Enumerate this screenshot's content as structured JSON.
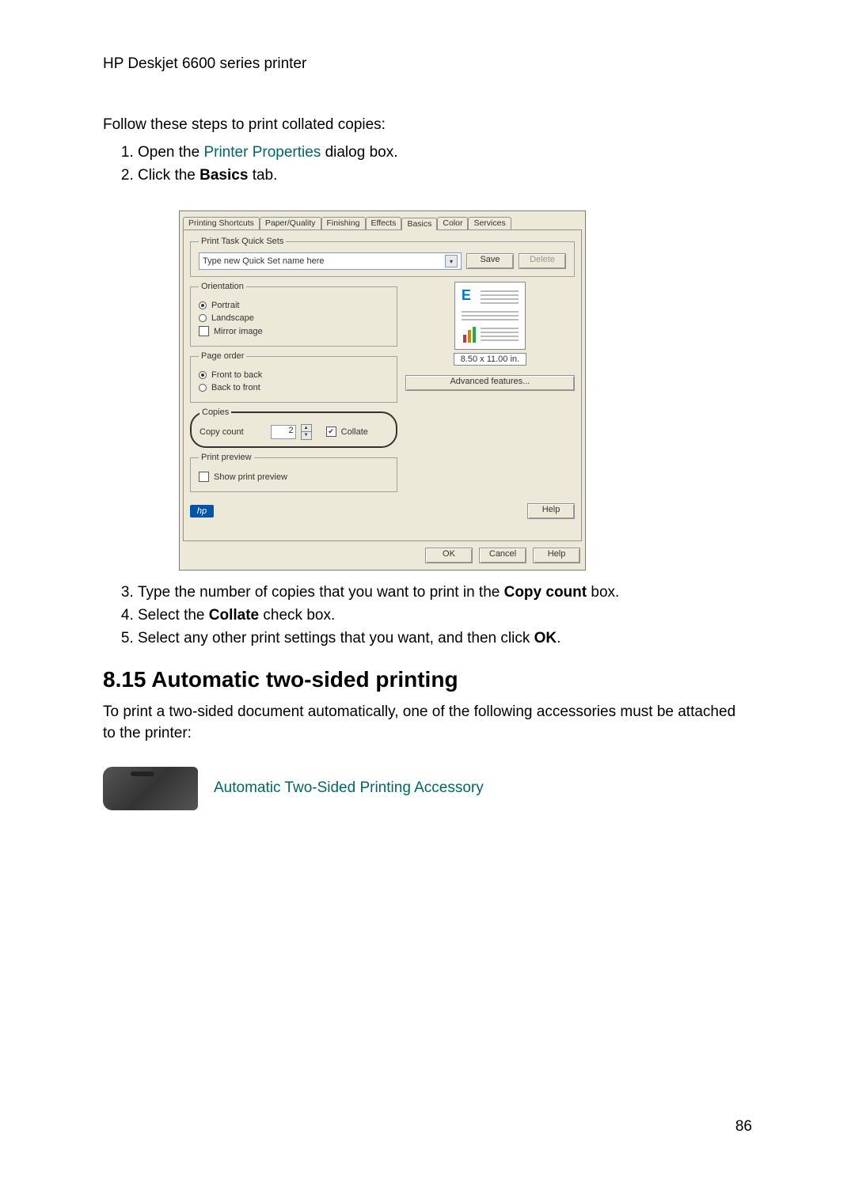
{
  "header": "HP Deskjet 6600 series printer",
  "intro": "Follow these steps to print collated copies:",
  "steps12": {
    "s1a": "Open the ",
    "s1_link": "Printer Properties",
    "s1b": " dialog box.",
    "s2a": "Click the ",
    "s2_bold": "Basics",
    "s2b": " tab."
  },
  "dialog": {
    "tabs": {
      "t0": "Printing Shortcuts",
      "t1": "Paper/Quality",
      "t2": "Finishing",
      "t3": "Effects",
      "t4": "Basics",
      "t5": "Color",
      "t6": "Services"
    },
    "quickset": {
      "legend": "Print Task Quick Sets",
      "placeholder": "Type new Quick Set name here",
      "save": "Save",
      "delete": "Delete"
    },
    "orientation": {
      "legend": "Orientation",
      "portrait": "Portrait",
      "landscape": "Landscape",
      "mirror": "Mirror image"
    },
    "pageorder": {
      "legend": "Page order",
      "ftb": "Front to back",
      "btf": "Back to front"
    },
    "copies": {
      "legend": "Copies",
      "label": "Copy count",
      "val": "2",
      "collate": "Collate"
    },
    "preview": {
      "legend": "Print preview",
      "show": "Show print preview"
    },
    "sizelabel": "8.50 x 11.00 in.",
    "advanced": "Advanced features...",
    "help1": "Help",
    "ok": "OK",
    "cancel": "Cancel",
    "help2": "Help",
    "hp": "hp"
  },
  "steps345": {
    "s3a": "Type the number of copies that you want to print in the ",
    "s3_bold": "Copy count",
    "s3b": " box.",
    "s4a": "Select the ",
    "s4_bold": "Collate",
    "s4b": " check box.",
    "s5a": "Select any other print settings that you want, and then click ",
    "s5_bold": "OK",
    "s5b": "."
  },
  "section": {
    "title": "8.15  Automatic two-sided printing",
    "body": "To print a two-sided document automatically, one of the following accessories must be attached to the printer:",
    "acc_link": "Automatic Two-Sided Printing Accessory"
  },
  "page_number": "86"
}
